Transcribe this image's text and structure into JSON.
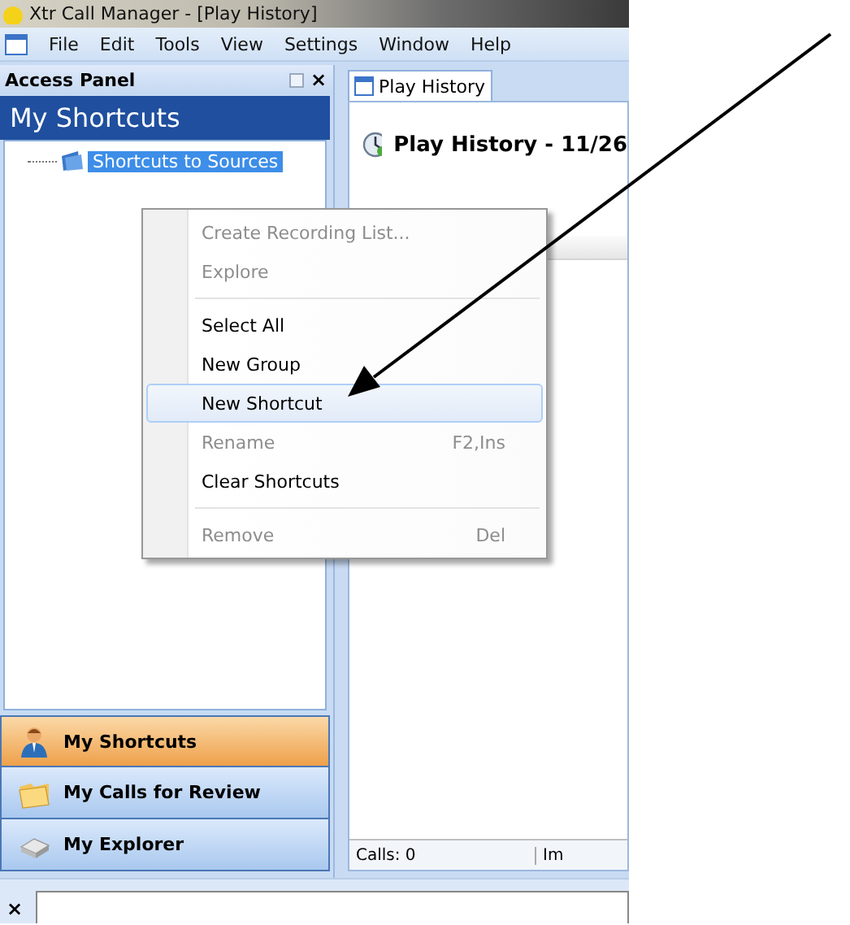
{
  "window": {
    "title": "Xtr Call Manager - [Play History]"
  },
  "menu_bar": [
    "File",
    "Edit",
    "Tools",
    "View",
    "Settings",
    "Window",
    "Help"
  ],
  "access_panel": {
    "title": "Access Panel",
    "close": "×",
    "section_title": "My Shortcuts",
    "tree": [
      {
        "label": "Shortcuts to Sources",
        "selected": true
      }
    ],
    "nav_buttons": [
      {
        "label": "My Shortcuts",
        "selected": true
      },
      {
        "label": "My Calls for Review",
        "selected": false
      },
      {
        "label": "My Explorer",
        "selected": false
      }
    ]
  },
  "document_tabs": [
    {
      "label": "Play History",
      "selected": true
    }
  ],
  "content": {
    "title": "Play History - 11/26",
    "status_bar": [
      "Calls: 0",
      "Im"
    ]
  },
  "context_menu": [
    {
      "kind": "item",
      "label": "Create Recording List...",
      "disabled": true,
      "highlighted": false
    },
    {
      "kind": "item",
      "label": "Explore",
      "disabled": true,
      "highlighted": false
    },
    {
      "kind": "separator"
    },
    {
      "kind": "item",
      "label": "Select All",
      "disabled": false,
      "highlighted": false
    },
    {
      "kind": "item",
      "label": "New Group",
      "disabled": false,
      "highlighted": false
    },
    {
      "kind": "item",
      "label": "New Shortcut",
      "disabled": false,
      "highlighted": true
    },
    {
      "kind": "item",
      "label": "Rename",
      "shortcut": "F2,Ins",
      "disabled": true,
      "highlighted": false
    },
    {
      "kind": "item",
      "label": "Clear Shortcuts",
      "disabled": false,
      "highlighted": false
    },
    {
      "kind": "separator"
    },
    {
      "kind": "item",
      "label": "Remove",
      "shortcut": "Del",
      "disabled": true,
      "highlighted": false
    }
  ],
  "command_bar": {
    "close": "×"
  }
}
